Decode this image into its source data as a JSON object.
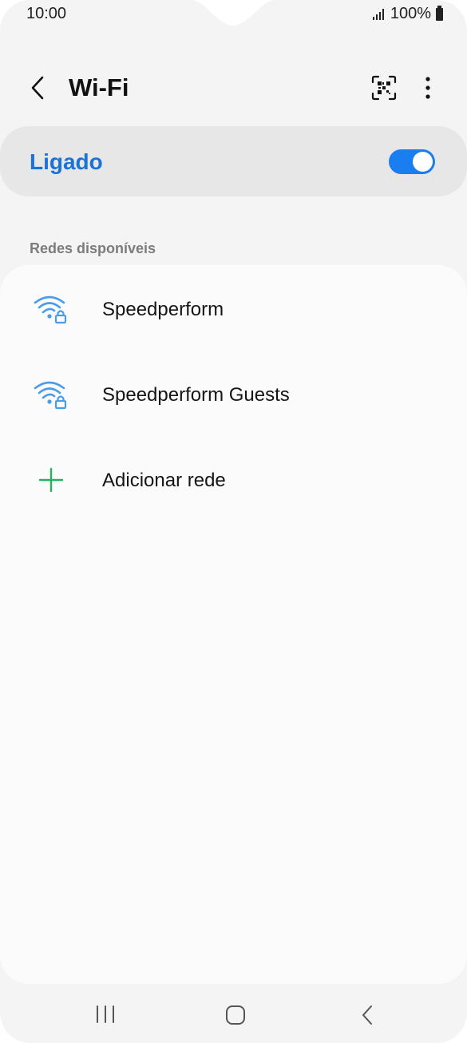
{
  "status_bar": {
    "time": "10:00",
    "battery": "100%"
  },
  "header": {
    "title": "Wi-Fi"
  },
  "wifi_toggle": {
    "label": "Ligado",
    "on": true
  },
  "section": {
    "label": "Redes disponíveis"
  },
  "networks": [
    {
      "name": "Speedperform",
      "icon": "wifi-lock-icon"
    },
    {
      "name": "Speedperform Guests",
      "icon": "wifi-lock-icon"
    }
  ],
  "add_network": {
    "label": "Adicionar rede",
    "icon": "plus-icon"
  },
  "colors": {
    "accent": "#1a73d9",
    "switch": "#1a7ef0",
    "add": "#2bb05a",
    "wifi": "#4a9ce8"
  }
}
